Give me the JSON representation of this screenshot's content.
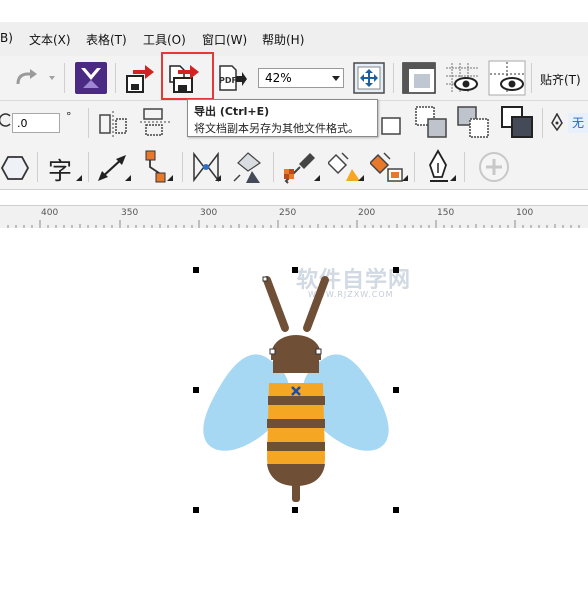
{
  "menu": {
    "cut_prefix": "B)",
    "text": "文本(X)",
    "table": "表格(T)",
    "tools": "工具(O)",
    "window": "窗口(W)",
    "help": "帮助(H)"
  },
  "toolbar": {
    "zoom_value": "42%",
    "snap_label": "贴齐(T)",
    "pdf_label": "PDF"
  },
  "tooltip": {
    "title": "导出 (Ctrl+E)",
    "description": "将文档副本另存为其他文件格式。"
  },
  "property_bar": {
    "rotation_value": ".0",
    "degree_symbol": "°",
    "lang_glyph": "无"
  },
  "toolbox": {
    "text_tool_glyph": "字"
  },
  "ruler": {
    "ticks": [
      "400",
      "350",
      "300",
      "250",
      "200",
      "150",
      "100"
    ]
  },
  "watermark": {
    "main": "软件自学网",
    "sub": "WWW.RJZXW.COM"
  },
  "colors": {
    "menu_bg": "#efefef",
    "toolbar_bg": "#f3f3f3",
    "highlight": "#e53935",
    "bee_body": "#6f4f35",
    "bee_stripe": "#f5a623",
    "bee_wing": "#a7d8f3",
    "export_arrow": "#d32222"
  }
}
